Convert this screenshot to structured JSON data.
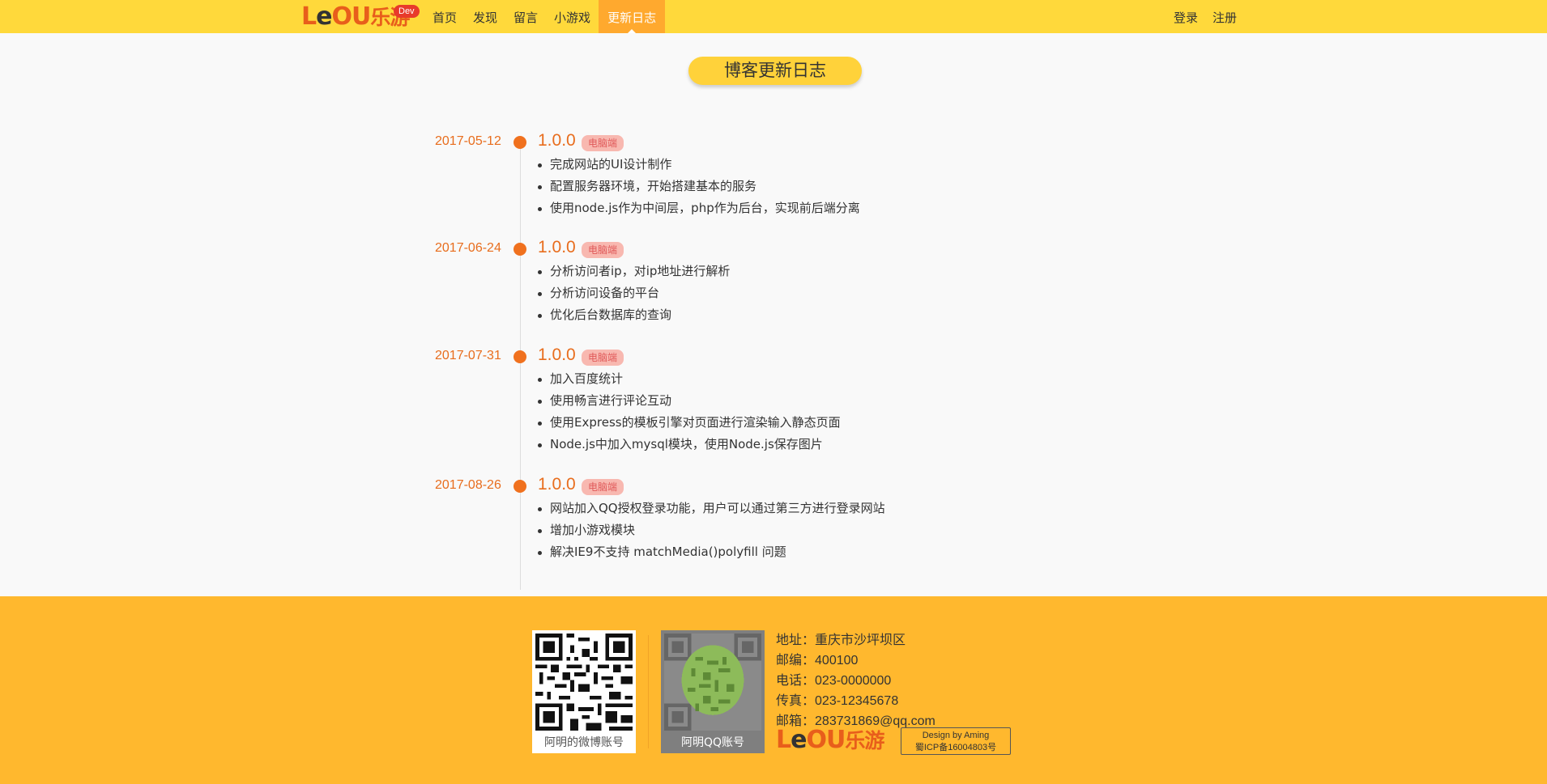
{
  "header": {
    "logo_text": "Leou乐游",
    "logo_main": "LeOU",
    "logo_cn": "乐游",
    "dev_badge": "Dev",
    "nav": [
      {
        "label": "首页"
      },
      {
        "label": "发现"
      },
      {
        "label": "留言"
      },
      {
        "label": "小游戏"
      },
      {
        "label": "更新日志",
        "active": true
      }
    ],
    "login_label": "登录",
    "register_label": "注册"
  },
  "page_title": "博客更新日志",
  "timeline": [
    {
      "date": "2017-05-12",
      "version": "1.0.0",
      "tag": "电脑端",
      "items": [
        "完成网站的UI设计制作",
        "配置服务器环境，开始搭建基本的服务",
        "使用node.js作为中间层，php作为后台，实现前后端分离"
      ]
    },
    {
      "date": "2017-06-24",
      "version": "1.0.0",
      "tag": "电脑端",
      "items": [
        "分析访问者ip，对ip地址进行解析",
        "分析访问设备的平台",
        "优化后台数据库的查询"
      ]
    },
    {
      "date": "2017-07-31",
      "version": "1.0.0",
      "tag": "电脑端",
      "items": [
        "加入百度统计",
        "使用畅言进行评论互动",
        "使用Express的模板引擎对页面进行渲染输入静态页面",
        "Node.js中加入mysql模块，使用Node.js保存图片"
      ]
    },
    {
      "date": "2017-08-26",
      "version": "1.0.0",
      "tag": "电脑端",
      "items": [
        "网站加入QQ授权登录功能，用户可以通过第三方进行登录网站",
        "增加小游戏模块",
        "解决IE9不支持 matchMedia()polyfill 问题"
      ]
    }
  ],
  "footer": {
    "weibo_caption": "阿明的微博账号",
    "qq_caption": "阿明QQ账号",
    "contact": [
      {
        "label": "地址：",
        "value": "重庆市沙坪坝区"
      },
      {
        "label": "邮编：",
        "value": "400100"
      },
      {
        "label": "电话：",
        "value": "023-0000000"
      },
      {
        "label": "传真：",
        "value": "023-12345678"
      },
      {
        "label": "邮箱：",
        "value": "283731869@qq.com"
      }
    ],
    "design_by": "Design by Aming",
    "icp": "蜀ICP备16004803号"
  },
  "colors": {
    "header_bg": "#ffd93b",
    "nav_active_bg": "#ffa92e",
    "accent_orange": "#e86d1d",
    "timeline_dot": "#f0711e",
    "tag_bg": "#f8b8b0",
    "footer_bg": "#ffb82e"
  }
}
